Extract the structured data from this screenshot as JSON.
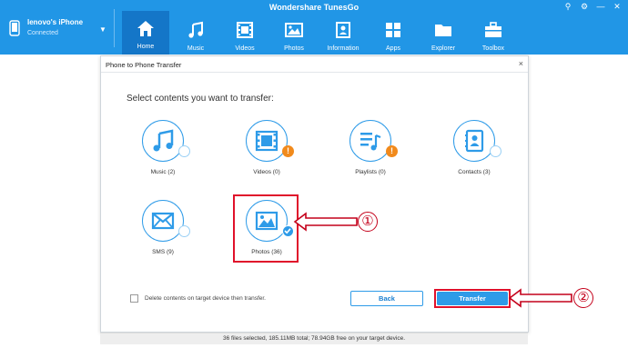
{
  "app": {
    "title": "Wondershare TunesGo",
    "window_controls": [
      "⚲",
      "⚙",
      "—",
      "✕"
    ]
  },
  "device": {
    "name": "lenovo's iPhone",
    "status": "Connected",
    "dropdown": "▼"
  },
  "nav": {
    "tabs": [
      {
        "label": "Home",
        "icon": "home-icon",
        "active": true
      },
      {
        "label": "Music",
        "icon": "music-note-icon",
        "active": false
      },
      {
        "label": "Videos",
        "icon": "film-icon",
        "active": false
      },
      {
        "label": "Photos",
        "icon": "image-icon",
        "active": false
      },
      {
        "label": "Information",
        "icon": "id-card-icon",
        "active": false
      },
      {
        "label": "Apps",
        "icon": "apps-grid-icon",
        "active": false
      },
      {
        "label": "Explorer",
        "icon": "folder-icon",
        "active": false
      },
      {
        "label": "Toolbox",
        "icon": "toolbox-icon",
        "active": false
      }
    ]
  },
  "dialog": {
    "title": "Phone to Phone Transfer",
    "close": "×",
    "instruction": "Select contents you want to transfer:",
    "items": [
      {
        "label": "Music (2)",
        "icon": "music-note-icon",
        "state": "unchecked"
      },
      {
        "label": "Videos (0)",
        "icon": "film-icon",
        "state": "warning"
      },
      {
        "label": "Playlists (0)",
        "icon": "playlist-icon",
        "state": "warning"
      },
      {
        "label": "Contacts (3)",
        "icon": "contacts-book-icon",
        "state": "unchecked"
      },
      {
        "label": "SMS (9)",
        "icon": "envelope-icon",
        "state": "unchecked"
      },
      {
        "label": "Photos (36)",
        "icon": "image-icon",
        "state": "checked"
      }
    ],
    "warning_mark": "!",
    "delete_option_label": "Delete contents on target device then transfer.",
    "delete_option_checked": false,
    "back_label": "Back",
    "transfer_label": "Transfer",
    "status": "36 files selected, 185.11MB total; 78.94GB free on your target device."
  },
  "annotations": {
    "callout_1": "①",
    "callout_2": "②",
    "highlight_color": "#e0112b"
  },
  "colors": {
    "topbar": "#2196e6",
    "active_tab": "#1476c8",
    "accent": "#2e9be8",
    "warning": "#f18a1c"
  }
}
